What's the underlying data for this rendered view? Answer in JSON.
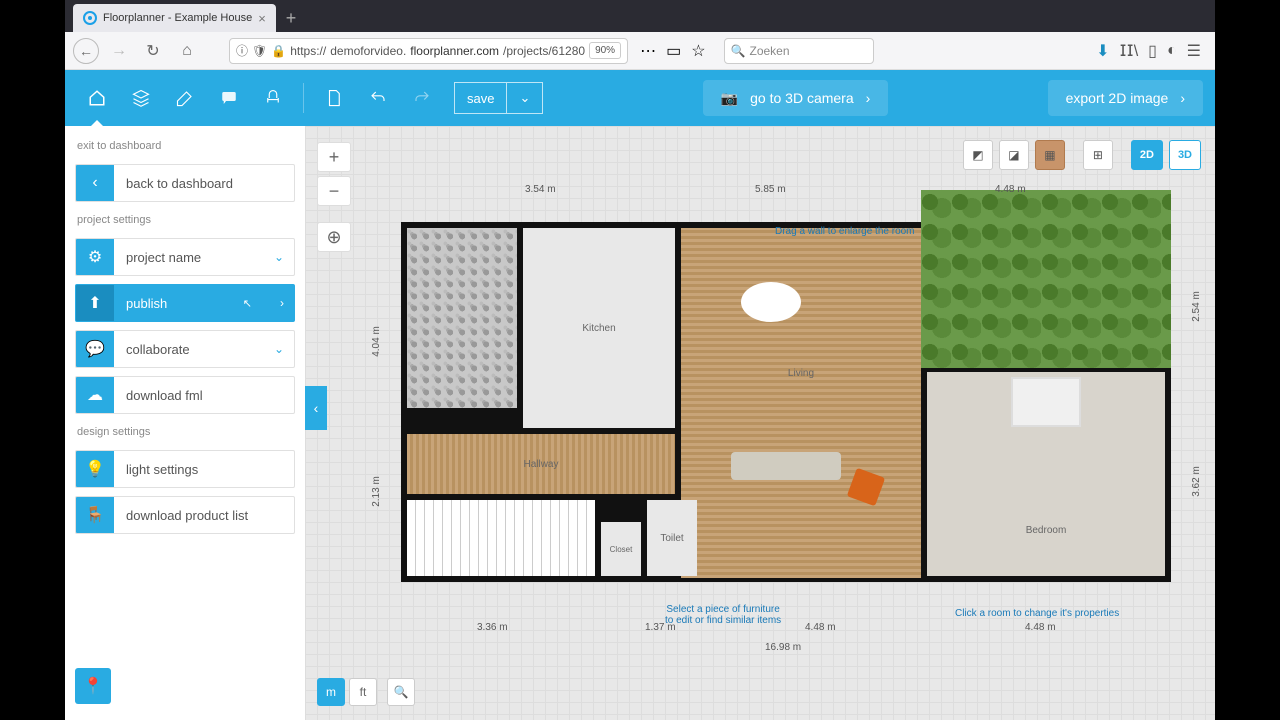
{
  "browser": {
    "tab_title": "Floorplanner - Example House",
    "url_prefix": "https://",
    "url_host": "demoforvideo.",
    "url_domain": "floorplanner.com",
    "url_path": "/projects/61280",
    "zoom": "90%",
    "search_placeholder": "Zoeken"
  },
  "toolbar": {
    "save": "save",
    "camera_btn": "go to 3D camera",
    "export_btn": "export 2D image"
  },
  "sidebar": {
    "exit_label": "exit to dashboard",
    "back": "back to dashboard",
    "proj_label": "project settings",
    "project_name": "project name",
    "publish": "publish",
    "collaborate": "collaborate",
    "download_fml": "download fml",
    "design_label": "design settings",
    "light": "light settings",
    "product_list": "download product list"
  },
  "canvas": {
    "dims_top": [
      "3.54 m",
      "5.85 m",
      "4.48 m"
    ],
    "dims_bottom": [
      "3.36 m",
      "1.37 m",
      "4.48 m",
      "4.48 m"
    ],
    "dim_total": "16.98 m",
    "dims_left": [
      "4.04 m",
      "2.13 m"
    ],
    "dims_right": [
      "2.54 m",
      "3.62 m"
    ],
    "rooms": {
      "kitchen": "Kitchen",
      "living": "Living",
      "hallway": "Hallway",
      "toilet": "Toilet",
      "closet": "Closet",
      "bedroom": "Bedroom"
    },
    "hints": {
      "drag": "Drag a wall to enlarge the room",
      "furniture": "Select a piece of furniture\nto edit or find similar items",
      "room": "Click a room to change it's properties"
    },
    "units": {
      "m": "m",
      "ft": "ft"
    },
    "views": {
      "v2d": "2D",
      "v3d": "3D"
    }
  }
}
